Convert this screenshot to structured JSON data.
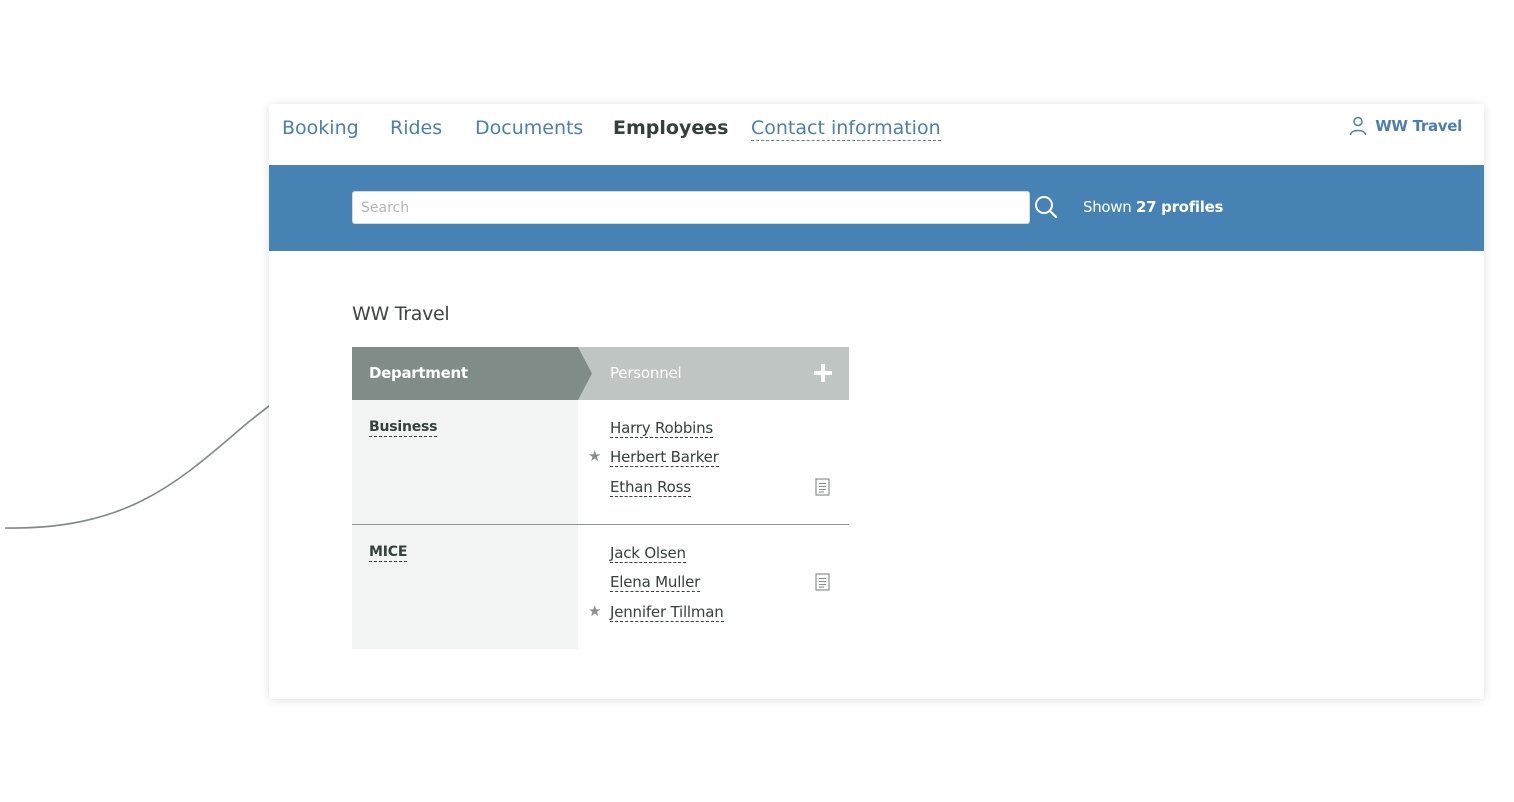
{
  "nav": {
    "items": [
      {
        "label": "Booking"
      },
      {
        "label": "Rides"
      },
      {
        "label": "Documents"
      },
      {
        "label": "Employees"
      },
      {
        "label": "Contact information"
      }
    ],
    "account_label": "WW Travel"
  },
  "search": {
    "placeholder": "Search",
    "shown_prefix": "Shown",
    "shown_count": "27 profiles"
  },
  "org": {
    "title": "WW Travel"
  },
  "table": {
    "col_department": "Department",
    "col_personnel": "Personnel",
    "departments": [
      {
        "name": "Business",
        "people": [
          {
            "name": "Harry Robbins",
            "starred": false,
            "doc": false
          },
          {
            "name": "Herbert Barker",
            "starred": true,
            "doc": false
          },
          {
            "name": "Ethan Ross",
            "starred": false,
            "doc": true
          }
        ]
      },
      {
        "name": "MICE",
        "people": [
          {
            "name": "Jack Olsen",
            "starred": false,
            "doc": false
          },
          {
            "name": "Elena Muller",
            "starred": false,
            "doc": true
          },
          {
            "name": "Jennifer Tillman",
            "starred": true,
            "doc": false
          }
        ]
      }
    ]
  },
  "colors": {
    "band": "#4682b4",
    "link": "#4a7fae",
    "dept_header": "#7f8c87",
    "personnel_header": "#bec5c3",
    "text_dark": "#34403d"
  },
  "icons": {
    "account": "user-icon",
    "search": "search-icon",
    "add": "plus-icon",
    "star": "star-icon",
    "document": "document-icon",
    "pointer": "arrow-icon"
  }
}
